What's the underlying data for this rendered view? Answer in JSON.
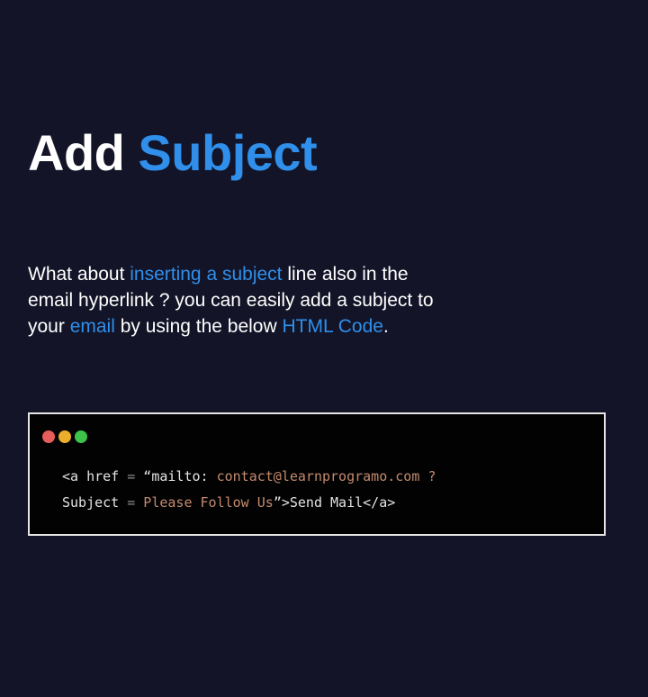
{
  "heading": {
    "part1": "Add",
    "part2": "Subject"
  },
  "description": {
    "segments": [
      "What about ",
      "inserting a subject",
      " line also in the email hyperlink ? you can easily add a subject to your ",
      "email",
      " by using the below ",
      "HTML Code",
      "."
    ]
  },
  "code_window": {
    "line1": {
      "tag": "<a href ",
      "eq": "=",
      "quote": " “mailto: ",
      "email": "contact@learnprogramo.com ?"
    },
    "line2": {
      "key": "Subject ",
      "eq": "=",
      "value": " Please Follow Us",
      "close": "”>Send Mail</a>"
    }
  },
  "colors": {
    "background": "#131427",
    "accent": "#2f8fea",
    "code_background": "#020203",
    "code_string": "#c48a6d",
    "dot_red": "#e65d5b",
    "dot_yellow": "#ecae2c",
    "dot_green": "#3dc34a"
  }
}
